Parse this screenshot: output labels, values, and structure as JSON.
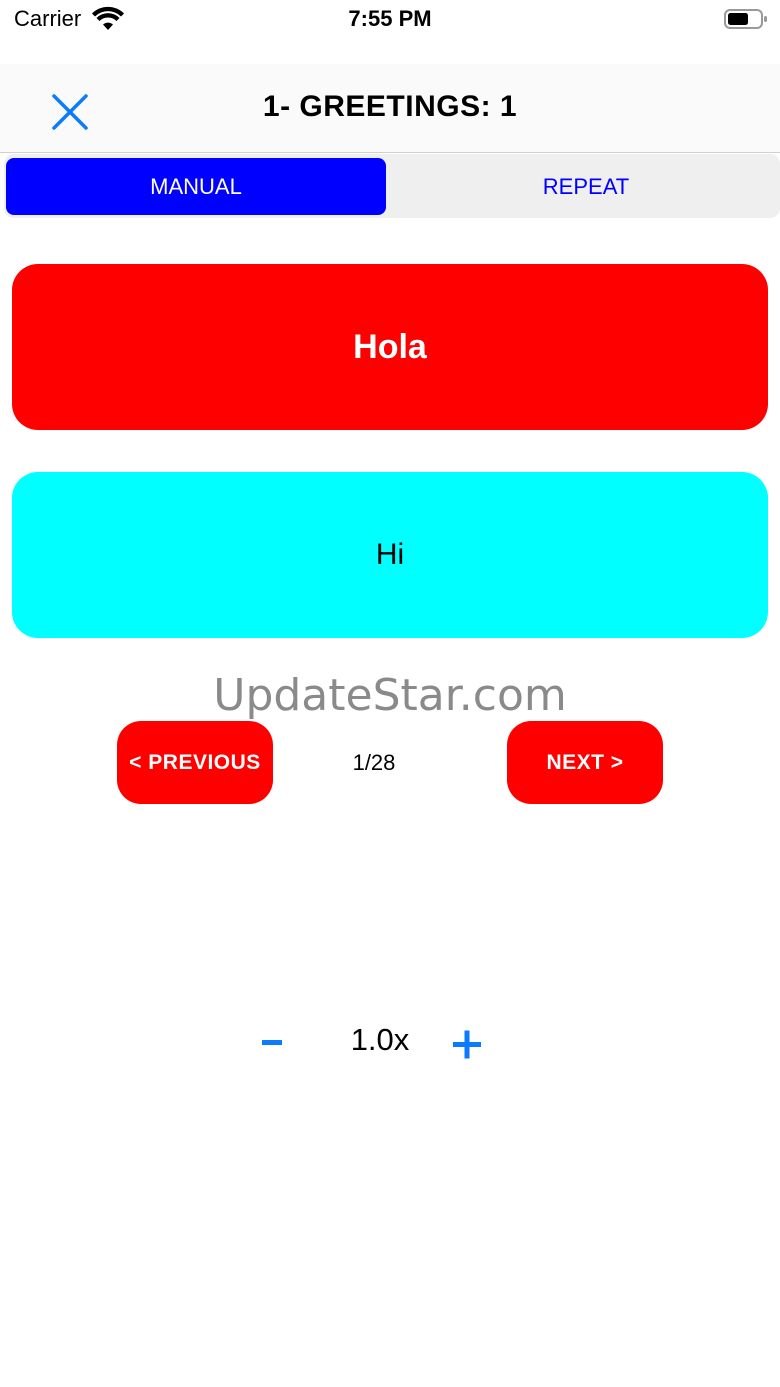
{
  "status_bar": {
    "carrier": "Carrier",
    "time": "7:55 PM",
    "wifi_icon": "wifi-icon",
    "battery_icon": "battery-icon"
  },
  "nav": {
    "title": "1- GREETINGS: 1",
    "close_icon": "close-icon",
    "accent_color": "#0a7aff"
  },
  "tabs": [
    {
      "label": "MANUAL",
      "selected": true
    },
    {
      "label": "REPEAT",
      "selected": false
    }
  ],
  "cards": {
    "spanish": "Hola",
    "english": "Hi",
    "spanish_color": "#ff0000",
    "english_color": "#00ffff"
  },
  "watermark": "UpdateStar.com",
  "pager": {
    "previous_label": "< PREVIOUS",
    "next_label": "NEXT >",
    "counter": "1/28",
    "button_color": "#ff0000"
  },
  "speed": {
    "value": "1.0x",
    "minus_icon": "minus-icon",
    "plus_icon": "plus-icon"
  }
}
